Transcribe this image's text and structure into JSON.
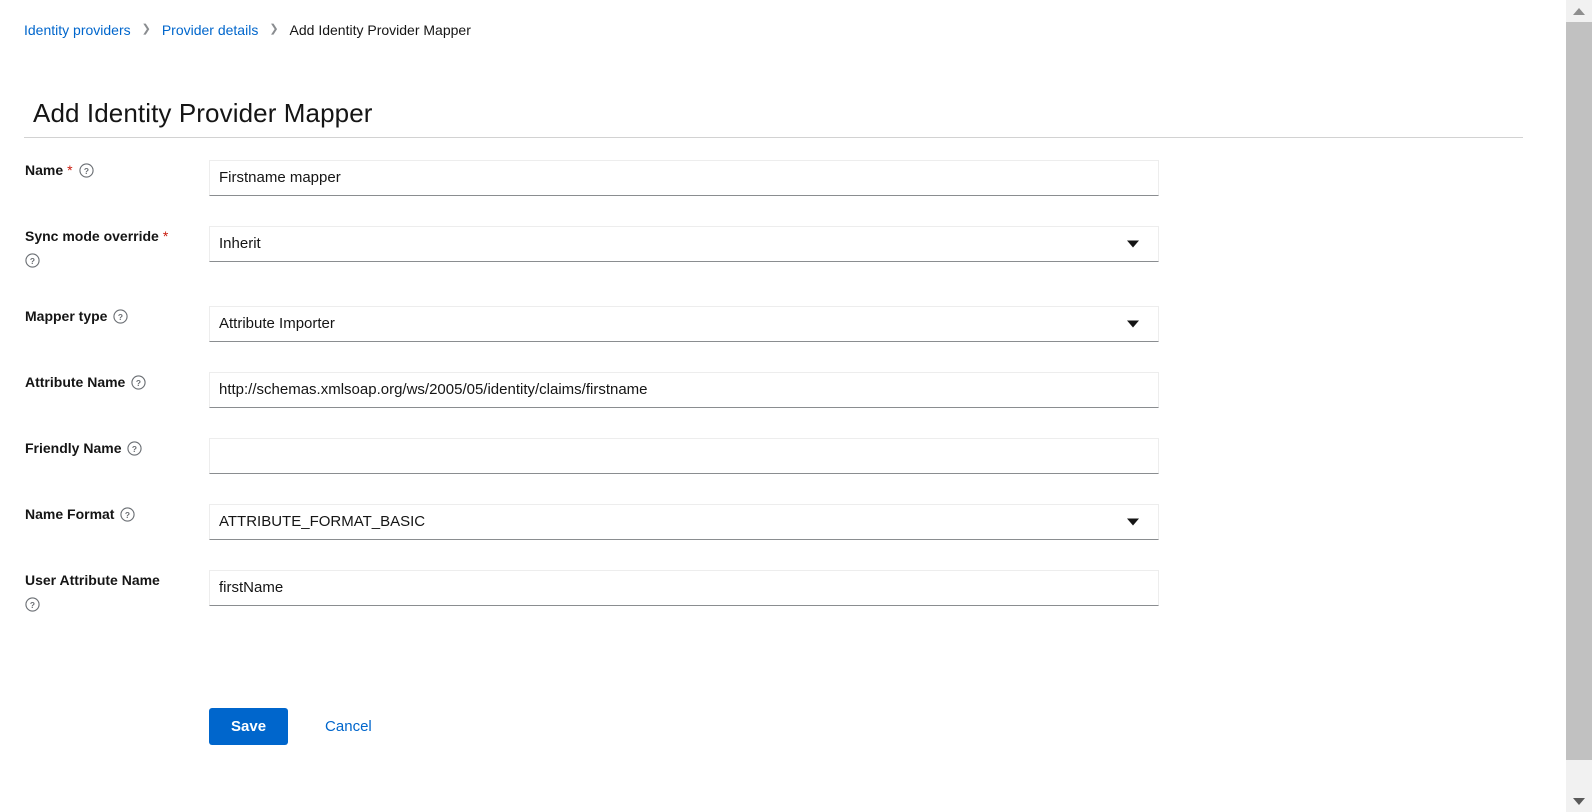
{
  "breadcrumb": {
    "items": [
      {
        "label": "Identity providers",
        "type": "link"
      },
      {
        "label": "Provider details",
        "type": "link"
      },
      {
        "label": "Add Identity Provider Mapper",
        "type": "current"
      }
    ],
    "separator": "❯"
  },
  "page": {
    "title": "Add Identity Provider Mapper"
  },
  "colors": {
    "link": "#0066cc",
    "primary_button": "#0066cc",
    "required_asterisk": "#c9190b",
    "text": "#151515",
    "input_underline": "#8a8d90"
  },
  "form": {
    "fields": [
      {
        "label": "Name",
        "required": true,
        "help_icon": "question-circle-icon",
        "control": "text",
        "value": "Firstname mapper",
        "placeholder": ""
      },
      {
        "label": "Sync mode override",
        "required": true,
        "help_icon": "question-circle-icon",
        "control": "select",
        "value": "Inherit",
        "caret_icon": "caret-down-icon"
      },
      {
        "label": "Mapper type",
        "required": false,
        "help_icon": "question-circle-icon",
        "control": "select",
        "value": "Attribute Importer",
        "caret_icon": "caret-down-icon"
      },
      {
        "label": "Attribute Name",
        "required": false,
        "help_icon": "question-circle-icon",
        "control": "text",
        "value": "http://schemas.xmlsoap.org/ws/2005/05/identity/claims/firstname",
        "placeholder": ""
      },
      {
        "label": "Friendly Name",
        "required": false,
        "help_icon": "question-circle-icon",
        "control": "text",
        "value": "",
        "placeholder": ""
      },
      {
        "label": "Name Format",
        "required": false,
        "help_icon": "question-circle-icon",
        "control": "select",
        "value": "ATTRIBUTE_FORMAT_BASIC",
        "caret_icon": "caret-down-icon"
      },
      {
        "label": "User Attribute Name",
        "required": false,
        "help_icon": "question-circle-icon",
        "control": "text",
        "value": "firstName",
        "placeholder": ""
      }
    ]
  },
  "actions": {
    "save_label": "Save",
    "cancel_label": "Cancel"
  },
  "scrollbar": {
    "up_arrow": "scroll-up-arrow-icon",
    "down_arrow": "scroll-down-arrow-icon"
  }
}
